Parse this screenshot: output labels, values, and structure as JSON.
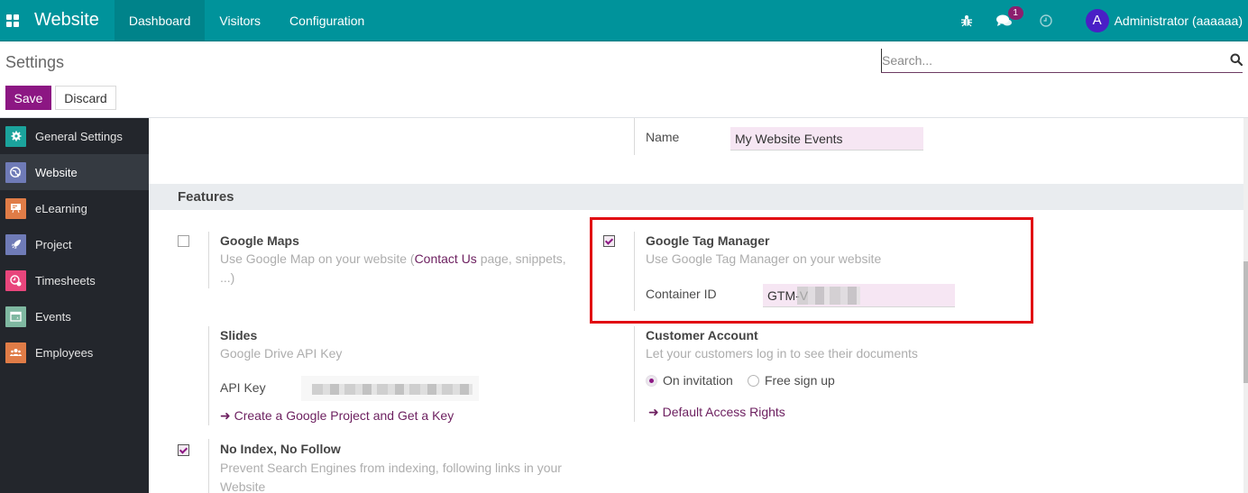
{
  "navbar": {
    "app_name": "Website",
    "menu": [
      {
        "label": "Dashboard",
        "active": true
      },
      {
        "label": "Visitors",
        "active": false
      },
      {
        "label": "Configuration",
        "active": false
      }
    ],
    "icons": [
      "debug-icon",
      "chat-icon",
      "activity-clock-icon"
    ],
    "messages_badge": "1",
    "avatar_letter": "A",
    "user_name": "Administrator (aaaaaa)"
  },
  "control_panel": {
    "title": "Settings",
    "save_label": "Save",
    "discard_label": "Discard",
    "search_placeholder": "Search...",
    "search_value": ""
  },
  "sidebar": {
    "items": [
      {
        "label": "General Settings",
        "icon": "gear-icon",
        "color": "#1ba39c",
        "active": false
      },
      {
        "label": "Website",
        "icon": "globe-icon",
        "color": "#6f7bb7",
        "active": true
      },
      {
        "label": "eLearning",
        "icon": "presentation-icon",
        "color": "#e07c47",
        "active": false
      },
      {
        "label": "Project",
        "icon": "rocket-icon",
        "color": "#6f7bb7",
        "active": false
      },
      {
        "label": "Timesheets",
        "icon": "clock-icon",
        "color": "#e8467c",
        "active": false
      },
      {
        "label": "Events",
        "icon": "calendar-icon",
        "color": "#7fb8a1",
        "active": false
      },
      {
        "label": "Employees",
        "icon": "users-icon",
        "color": "#e07c47",
        "active": false
      }
    ]
  },
  "main": {
    "website_name_label": "Name",
    "website_name_value": "My Website Events",
    "section_title": "Features",
    "google_maps": {
      "title": "Google Maps",
      "desc_before": "Use Google Map on your website (",
      "desc_link": "Contact Us",
      "desc_after": " page, snippets, ...)",
      "checked": false
    },
    "google_tag_manager": {
      "title": "Google Tag Manager",
      "desc": "Use Google Tag Manager on your website",
      "field_label": "Container ID",
      "field_value": "GTM-V",
      "checked": true
    },
    "slides": {
      "title": "Slides",
      "desc": "Google Drive API Key",
      "field_label": "API Key",
      "link": "Create a Google Project and Get a Key"
    },
    "customer_account": {
      "title": "Customer Account",
      "desc": "Let your customers log in to see their documents",
      "options": [
        {
          "label": "On invitation",
          "checked": true
        },
        {
          "label": "Free sign up",
          "checked": false
        }
      ],
      "link": "Default Access Rights"
    },
    "no_index": {
      "title": "No Index, No Follow",
      "desc": "Prevent Search Engines from indexing, following links in your Website",
      "checked": true
    }
  },
  "colors": {
    "navbar": "#00939b",
    "primary": "#8c1783",
    "link": "#6c1f5f",
    "highlight": "#e10a12"
  }
}
